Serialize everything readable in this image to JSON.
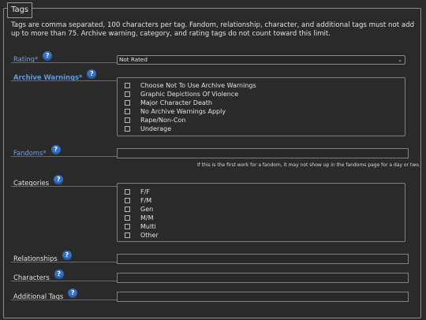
{
  "legend": "Tags",
  "intro": "Tags are comma separated, 100 characters per tag. Fandom, relationship, character, and additional tags must not add up to more than 75. Archive warning, category, and rating tags do not count toward this limit.",
  "help_glyph": "?",
  "rating": {
    "label": "Rating*",
    "value": "Not Rated",
    "chevron": "⌄"
  },
  "warnings": {
    "label": "Archive Warnings*",
    "options": [
      "Choose Not To Use Archive Warnings",
      "Graphic Depictions Of Violence",
      "Major Character Death",
      "No Archive Warnings Apply",
      "Rape/Non-Con",
      "Underage"
    ]
  },
  "fandoms": {
    "label": "Fandoms*",
    "value": "",
    "note": "If this is the first work for a fandom, it may not show up in the fandoms page for a day or two."
  },
  "categories": {
    "label": "Categories",
    "options": [
      "F/F",
      "F/M",
      "Gen",
      "M/M",
      "Multi",
      "Other"
    ]
  },
  "relationships": {
    "label": "Relationships",
    "value": ""
  },
  "characters": {
    "label": "Characters",
    "value": ""
  },
  "additional_tags": {
    "label": "Additional Tags",
    "value": ""
  },
  "colors": {
    "background": "#2a2a2a",
    "required_label": "#6fa0e0",
    "help_icon": "#3572c7"
  }
}
